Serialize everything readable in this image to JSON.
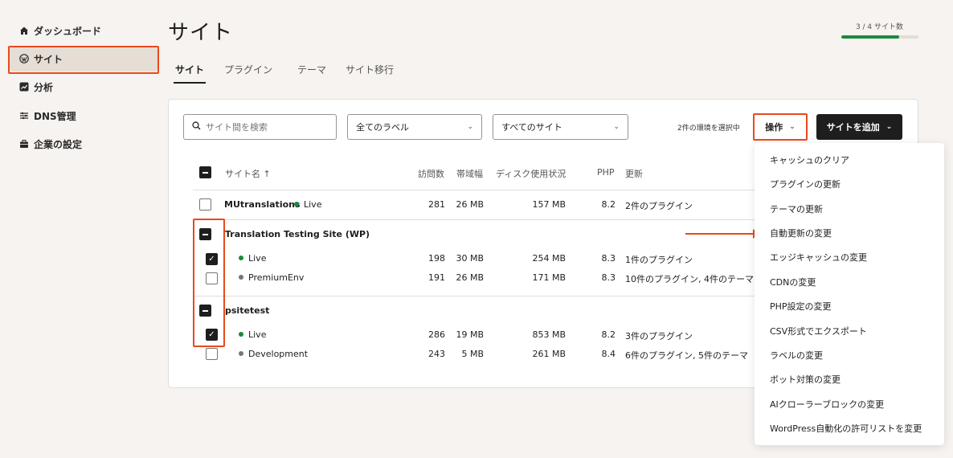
{
  "sidebar": {
    "items": [
      {
        "label": "ダッシュボード",
        "icon": "home-icon"
      },
      {
        "label": "サイト",
        "icon": "wordpress-icon"
      },
      {
        "label": "分析",
        "icon": "chart-icon"
      },
      {
        "label": "DNS管理",
        "icon": "dns-icon"
      },
      {
        "label": "企業の設定",
        "icon": "briefcase-icon"
      }
    ]
  },
  "header": {
    "title": "サイト",
    "usage_label": "3 / 4 サイト数",
    "usage_fraction": 0.75
  },
  "tabs": [
    "サイト",
    "プラグイン",
    "テーマ",
    "サイト移行"
  ],
  "toolbar": {
    "search_placeholder": "サイト間を検索",
    "label_filter": "全てのラベル",
    "site_filter": "すべてのサイト",
    "selected_count": "2件の環境を選択中",
    "actions_label": "操作",
    "add_site_label": "サイトを追加"
  },
  "table": {
    "columns": [
      "サイト名 ↑",
      "訪問数",
      "帯域幅",
      "ディスク使用状況",
      "PHP",
      "更新"
    ],
    "sites": [
      {
        "name": "MUtranslations",
        "env": "Live",
        "visits": "281",
        "bandwidth": "26 MB",
        "disk": "157 MB",
        "php": "8.2",
        "updates": "2件のプラグイン"
      },
      {
        "name": "Translation Testing Site (WP)",
        "envs": [
          {
            "name": "Live",
            "visits": "198",
            "bandwidth": "30 MB",
            "disk": "254 MB",
            "php": "8.3",
            "updates": "1件のプラグイン"
          },
          {
            "name": "PremiumEnv",
            "visits": "191",
            "bandwidth": "26 MB",
            "disk": "171 MB",
            "php": "8.3",
            "updates": "10件のプラグイン, 4件のテーマ"
          }
        ]
      },
      {
        "name": "psitetest",
        "envs": [
          {
            "name": "Live",
            "visits": "286",
            "bandwidth": "19 MB",
            "disk": "853 MB",
            "php": "8.2",
            "updates": "3件のプラグイン"
          },
          {
            "name": "Development",
            "visits": "243",
            "bandwidth": "5 MB",
            "disk": "261 MB",
            "php": "8.4",
            "updates": "6件のプラグイン, 5件のテーマ"
          }
        ]
      }
    ]
  },
  "actions_menu": [
    "キャッシュのクリア",
    "プラグインの更新",
    "テーマの更新",
    "自動更新の変更",
    "エッジキャッシュの変更",
    "CDNの変更",
    "PHP設定の変更",
    "CSV形式でエクスポート",
    "ラベルの変更",
    "ボット対策の変更",
    "AIクローラーブロックの変更",
    "WordPress自動化の許可リストを変更"
  ],
  "colors": {
    "accent": "#e9491d",
    "live": "#1a8a3b",
    "primary_button": "#1e1e1e"
  }
}
